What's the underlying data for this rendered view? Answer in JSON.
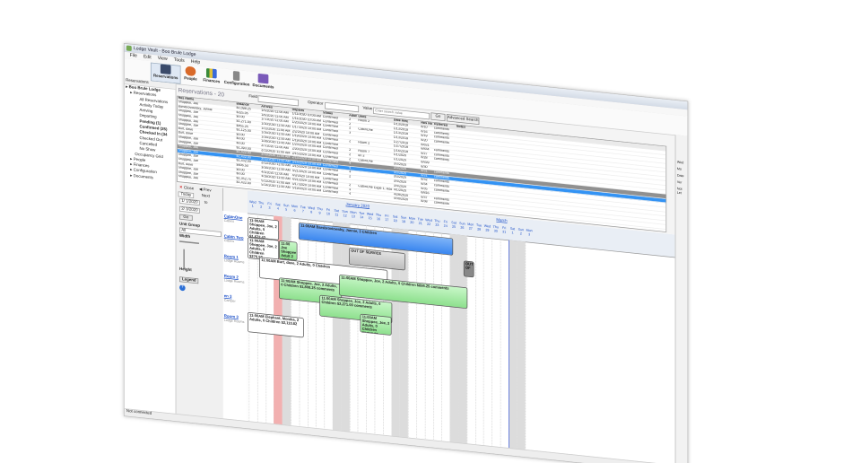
{
  "window": {
    "title": "Lodge Vault - Boo Brule Lodge"
  },
  "menu": [
    "File",
    "Edit",
    "View",
    "Tools",
    "Help"
  ],
  "toolbar": {
    "reservations": "Reservations",
    "people": "People",
    "finances": "Finances",
    "configuration": "Configuration",
    "documents": "Documents"
  },
  "left": {
    "title": "Reservations",
    "tree": [
      {
        "label": "Boo Brule Lodge",
        "bold": true,
        "indent": 0
      },
      {
        "label": "Reservations",
        "bold": false,
        "indent": 1
      },
      {
        "label": "All Reservations",
        "bold": false,
        "indent": 3
      },
      {
        "label": "Activity Today",
        "bold": false,
        "indent": 3
      },
      {
        "label": "Arriving",
        "bold": false,
        "indent": 3
      },
      {
        "label": "Departing",
        "bold": false,
        "indent": 3
      },
      {
        "label": "Pending (1)",
        "bold": true,
        "indent": 3
      },
      {
        "label": "Confirmed (25)",
        "bold": true,
        "indent": 3
      },
      {
        "label": "Checked In (34",
        "bold": true,
        "indent": 3
      },
      {
        "label": "Checked Out",
        "bold": false,
        "indent": 3
      },
      {
        "label": "Cancelled",
        "bold": false,
        "indent": 3
      },
      {
        "label": "No Show",
        "bold": false,
        "indent": 3
      },
      {
        "label": "Occupancy Grid",
        "bold": false,
        "indent": 2
      },
      {
        "label": "People",
        "bold": false,
        "indent": 1
      },
      {
        "label": "Finances",
        "bold": false,
        "indent": 1
      },
      {
        "label": "Configuration",
        "bold": false,
        "indent": 1
      },
      {
        "label": "Documents",
        "bold": false,
        "indent": 1
      }
    ]
  },
  "status": "Not connected",
  "resv": {
    "heading": "Reservations - 20",
    "field_label": "Field",
    "operator_label": "Operator",
    "value_label": "Value",
    "value_placeholder": "Enter search value",
    "go": "Go",
    "advanced": "Advanced Search",
    "columns": [
      "Res Name",
      "Balance",
      "Arrives",
      "Departs",
      "Status",
      "Adults",
      "Units",
      "Date Req",
      "Res No",
      "Referred",
      "Notes"
    ],
    "rows": [
      [
        "Shoppee, Joe",
        "$1,098.25",
        "1/5/2020 11:00 AM",
        "1/11/2020 10:00 AM",
        "Confirmed",
        "2",
        "Room 2",
        "1/13/2019",
        "8/10",
        "comments",
        ""
      ],
      [
        "Barsbroviowsky, Jannie",
        "$325.05",
        "1/6/2020 11:00 AM",
        "1/11/2020 10:00 AM",
        "Confirmed",
        "2",
        "",
        "1/13/2019",
        "8/16",
        "comments",
        ""
      ],
      [
        "Shoppee, Joe",
        "$0.00",
        "1/7/2020 11:00 AM",
        "1/20/2020 10:00 AM",
        "Confirmed",
        "2",
        "CabinOne",
        "1/13/2019",
        "8/19",
        "comments",
        ""
      ],
      [
        "Shoppee, Joe",
        "$1,271.00",
        "1/10/2020 11:00 AM",
        "1/17/2020 10:00 AM",
        "Confirmed",
        "3",
        "",
        "1/13/2019",
        "8/20",
        "comments",
        ""
      ],
      [
        "Shoppee, Joe",
        "$855.25",
        "1/11/2020 11:00 AM",
        "2/2/2020 10:00 AM",
        "Confirmed",
        "",
        "",
        "1/27/2019",
        "8/831",
        "",
        ""
      ],
      [
        "Shoppee, Joe",
        "$1,125.00",
        "1/16/2020 11:00 AM",
        "1/19/2020 10:00 AM",
        "Confirmed",
        "2",
        "Room 2",
        "1/27/2019",
        "8/834",
        "comments",
        ""
      ],
      [
        "Burt, dave",
        "$0.00",
        "1/16/2020 11:00 AM",
        "1/19/2020 10:00 AM",
        "Confirmed",
        "",
        "",
        "1/16/2019",
        "8/27",
        "comments",
        ""
      ],
      [
        "Burt, dave",
        "$0.00",
        "1/28/2020 11:00 AM",
        "1/23/2020 10:00 AM",
        "Confirmed",
        "2",
        "Room 7",
        "1/1/2020",
        "8/28",
        "comments",
        ""
      ],
      [
        "Shoppee, Joe",
        "$0.00",
        "2/7/2020 11:00 AM",
        "2/20/2020 10:00 AM",
        "Confirmed",
        "2",
        "en 3",
        "1/1/2020",
        "8/829",
        "",
        ""
      ],
      [
        "Shoppee, Joe",
        "$1,393.00",
        "2/11/2020 11:00 AM",
        "2/15/2020 10:00 AM",
        "Confirmed",
        "2",
        "CabinOne",
        "3/3/2020",
        "8/30",
        "",
        ""
      ],
      [
        "Shoppee, Joe",
        "$1,432.00",
        "2/11/2020 11:00 AM",
        "2/15/2020 10:00 AM",
        "Confirmed",
        "4",
        "",
        "3/3/2020",
        "8/31",
        "comments",
        ""
      ],
      [
        "Shoppee, Joe",
        "$1,432.00",
        "2/12/2020 11:00 AM",
        "3/15/2020 10:00 AM",
        "Confirmed",
        "4",
        "",
        "3/3/2020",
        "8/31",
        "comments",
        ""
      ],
      [
        "Shoppee, Joe",
        "$1,432.00",
        "2/12/2020 11:00 AM",
        "3/15/2020 10:00 AM",
        "Confirmed",
        "4",
        "",
        "3/3/2020",
        "8/32",
        "comments",
        ""
      ],
      [
        "Shoppee, Joe",
        "$606.50",
        "3/16/2020 11:00 AM",
        "3/21/2020 10:00 AM",
        "Confirmed",
        "2",
        "",
        "3/4/2020",
        "8/34",
        "comments",
        ""
      ],
      [
        "Burt, dave",
        "$0.00",
        "4/1/2020 11:00 AM",
        "4/3/2020 10:00 AM",
        "Confirmed",
        "",
        "",
        "3/4/2020",
        "8/35",
        "comments",
        ""
      ],
      [
        "Shoppee, Joe",
        "$0.00",
        "4/18/2020 11:00 AM",
        "4/21/2020 10:00 AM",
        "Confirmed",
        "2",
        "CabinOne Cape 1, Room 3",
        "4/1/2020",
        "8/816",
        "",
        ""
      ],
      [
        "Shoppee, Joe",
        "$1,352.75",
        "5/11/2020 11:00 AM",
        "5/17/2020 10:00 AM",
        "Confirmed",
        "4",
        "",
        "4/29/2020",
        "8/37",
        "comments",
        ""
      ],
      [
        "Shoppee, Joe",
        "$1,432.00",
        "5/14/2020 11:00 AM",
        "5/19/2020 10:00 AM",
        "Confirmed",
        "4",
        "",
        "4/30/2020",
        "8/38",
        "comments",
        ""
      ]
    ],
    "selected_row": 11,
    "gray_row": 10
  },
  "cal": {
    "close": "Close",
    "prev": "Prev",
    "today": "Today",
    "next": "Next",
    "from_date": "1/ 1/2020",
    "to_label": "to",
    "to_date": "2/ 3/2020",
    "go": "Go",
    "unit_group_label": "Unit Group",
    "unit_group_value": "All",
    "width_label": "Width",
    "height_label": "Height",
    "legend": "Legend",
    "month_label": "January 2020",
    "month2_label": "March",
    "days": [
      "Wed",
      "Thu",
      "Fri",
      "Sat",
      "Sun",
      "Mon",
      "Tue",
      "Wed",
      "Thu",
      "Fri",
      "Sat",
      "Sun",
      "Mon",
      "Tue",
      "Wed",
      "Thu",
      "Fri",
      "Sat",
      "Sun",
      "Mon",
      "Tue",
      "Wed",
      "Thu",
      "Fri",
      "Sat",
      "Sun",
      "Mon",
      "Tue",
      "Wed",
      "Thu",
      "Fri",
      "Sat",
      "Sun",
      "Mon"
    ],
    "dates": [
      "1",
      "2",
      "3",
      "4",
      "5",
      "6",
      "7",
      "8",
      "9",
      "10",
      "11",
      "12",
      "13",
      "14",
      "15",
      "16",
      "17",
      "18",
      "19",
      "20",
      "21",
      "22",
      "23",
      "24",
      "25",
      "26",
      "27",
      "28",
      "29",
      "30",
      "31",
      "1",
      "2",
      "3"
    ],
    "rooms": [
      {
        "name": "CabinOne",
        "sub": "Cabins"
      },
      {
        "name": "Cabin Two",
        "sub": "Cabins"
      },
      {
        "name": "Room 1",
        "sub": "Lodge Rooms"
      },
      {
        "name": "Room 2",
        "sub": "Lodge Rooms"
      },
      {
        "name": "en 3",
        "sub": "Camper"
      },
      {
        "name": "Room 3",
        "sub": "Lodge Rooms"
      }
    ],
    "bookings": [
      {
        "text": "11:00AM Shoppee, Joe, 2 Adults, 0 Children $1,673.42 comments",
        "color": "white"
      },
      {
        "text": "11:00AM Barsbroviowsky, Jannie, 3 Children",
        "color": "blue"
      },
      {
        "text": "OUT OF SERVICE",
        "color": "grey"
      },
      {
        "text": "OUT OF",
        "color": "dark"
      },
      {
        "text": "11:00AM Shoppee, Joe, 2 Adults, 0 Children $276.52 comments",
        "color": "white"
      },
      {
        "text": "11:00 Joe Shoppee Adult 2 Adults",
        "color": "green"
      },
      {
        "text": "11:00AM Burt, dave, 2 Adults, 0 Children",
        "color": "white"
      },
      {
        "text": "11:00AM Shoppee, Joe, 2 Adults, 0 Children $1,808.25 comments",
        "color": "green"
      },
      {
        "text": "11:00AM Shoppee, Joe, 2 Adults, 0 Children $895.25 comments",
        "color": "green"
      },
      {
        "text": "11:00AM Shoppee, Joe, 2 Adults, 0 Children $2,271.00 comments",
        "color": "green"
      },
      {
        "text": "11:00AM Shoppee, Joe, 2 Adults, 0 Children $1,098.25",
        "color": "green"
      },
      {
        "text": "11:00AM Elephant, Monika, 2 Adults, 0 Children $2,110.82",
        "color": "white"
      }
    ]
  },
  "right": [
    "Wed",
    "Mo",
    "Date",
    "Ver",
    "Not Let"
  ]
}
